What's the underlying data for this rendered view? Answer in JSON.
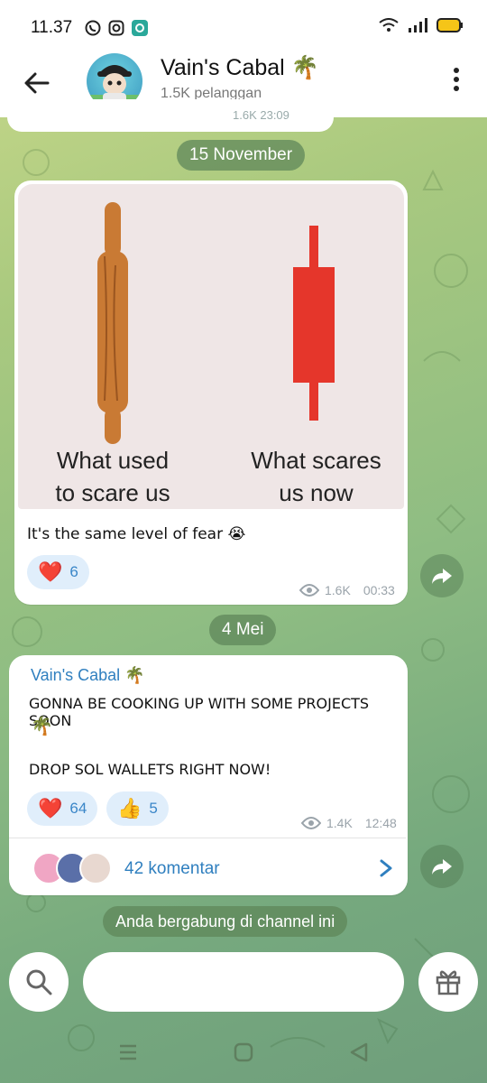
{
  "status_bar": {
    "time": "11.37",
    "left_icons": [
      "whatsapp-icon",
      "instagram-icon",
      "app-icon"
    ],
    "right_icons": [
      "wifi-icon",
      "signal-icon",
      "battery-icon"
    ]
  },
  "header": {
    "title": "Vain's Cabal 🌴",
    "subtitle": "1.5K pelanggan"
  },
  "previous_message": {
    "meta": "1.6K 23:09"
  },
  "dates": {
    "first": "15 November",
    "second": "4 Mei"
  },
  "post1": {
    "image_caption_left": "What used to scare us",
    "image_caption_right": "What scares us now",
    "text": "It's the same level of fear 😭",
    "reactions": [
      {
        "emoji": "❤️",
        "count": "6"
      }
    ],
    "views": "1.6K",
    "time": "00:33"
  },
  "post2": {
    "sender": "Vain's Cabal 🌴",
    "line1": "GONNA BE COOKING UP WITH SOME PROJECTS SOON",
    "line1_emoji": "🌴",
    "line2": "DROP SOL WALLETS RIGHT NOW!",
    "reactions": [
      {
        "emoji": "❤️",
        "count": "64"
      },
      {
        "emoji": "👍",
        "count": "5"
      }
    ],
    "views": "1.4K",
    "time": "12:48",
    "comments": "42 komentar"
  },
  "joined_notice": "Anda bergabung di channel ini",
  "colors": {
    "accent": "#2f7fbf",
    "reaction_bg": "#e0eefb",
    "candle_red": "#e5362b",
    "rolling_pin": "#c97a34"
  }
}
